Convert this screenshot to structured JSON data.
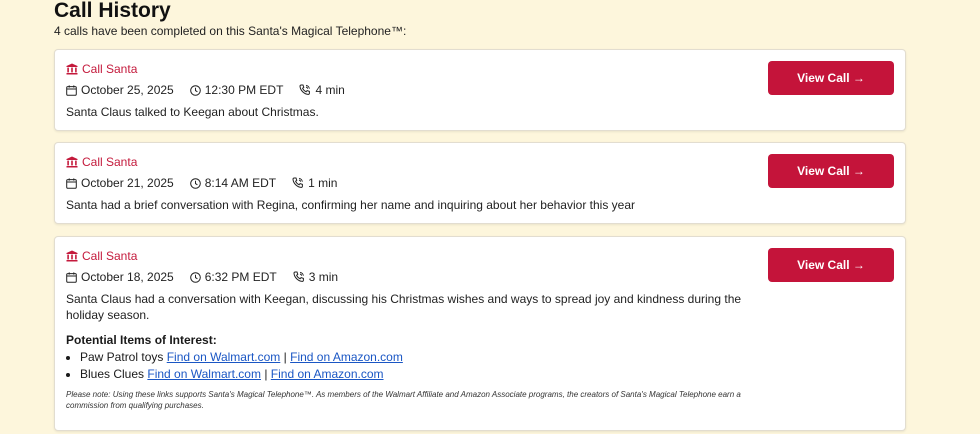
{
  "header": {
    "title": "Call History",
    "subtitle": "4 calls have been completed on this Santa's Magical Telephone™:"
  },
  "calls": [
    {
      "label": "Call Santa",
      "date": "October 25, 2025",
      "time": "12:30 PM EDT",
      "duration": "4 min",
      "summary": "Santa Claus talked to Keegan about Christmas.",
      "button": "View Call →"
    },
    {
      "label": "Call Santa",
      "date": "October 21, 2025",
      "time": "8:14 AM EDT",
      "duration": "1 min",
      "summary": "Santa had a brief conversation with Regina, confirming her name and inquiring about her behavior this year",
      "button": "View Call →"
    },
    {
      "label": "Call Santa",
      "date": "October 18, 2025",
      "time": "6:32 PM EDT",
      "duration": "3 min",
      "summary": "Santa Claus had a conversation with Keegan, discussing his Christmas wishes and ways to spread joy and kindness during the holiday season.",
      "button": "View Call →",
      "interest_title": "Potential Items of Interest:",
      "items": [
        {
          "name": "Paw Patrol toys",
          "walmart": "Find on Walmart.com",
          "separator": "|",
          "amazon": "Find on Amazon.com"
        },
        {
          "name": "Blues Clues",
          "walmart": "Find on Walmart.com",
          "separator": "|",
          "amazon": "Find on Amazon.com"
        }
      ],
      "note": "Please note: Using these links supports Santa's Magical Telephone™. As members of the Walmart Affiliate and Amazon Associate programs, the creators of Santa's Magical Telephone earn a commission from qualifying purchases."
    }
  ],
  "colors": {
    "accent": "#c4143a",
    "background": "#fdf6dc",
    "link": "#1a56c4"
  },
  "icons": {
    "call_label": "building-icon",
    "date": "calendar-icon",
    "time": "clock-icon",
    "duration": "phone-icon"
  }
}
